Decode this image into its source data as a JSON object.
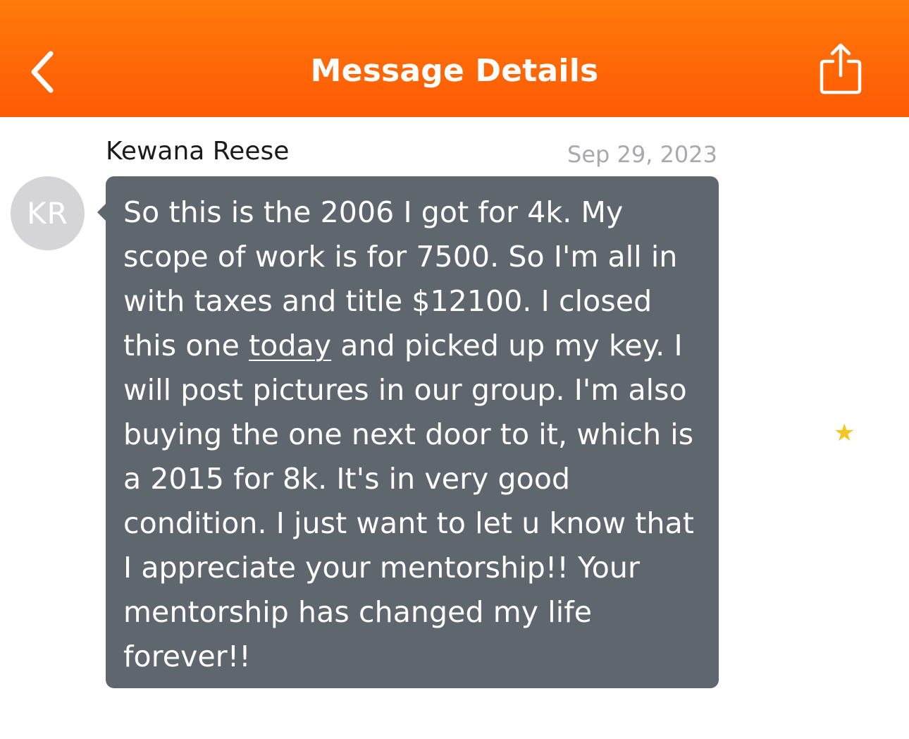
{
  "header": {
    "title": "Message Details",
    "back_icon": "chevron-left-icon",
    "share_icon": "share-icon",
    "background_color": "#ff6a08"
  },
  "message": {
    "sender_name": "Kewana Reese",
    "avatar_initials": "KR",
    "date": "Sep 29, 2023",
    "text_before_link": "So this is the 2006 I got for 4k. My scope of work is for 7500. So I'm all in with taxes and title $12100. I closed this one ",
    "link_text": "today",
    "text_after_link": " and picked up my key. I will post pictures in our group. I'm also buying the one next door to it, which is a 2015 for 8k. It's in very good condition. I just want to let u know that I appreciate your mentorship!! Your mentorship has changed my life forever!!",
    "bubble_color": "#5f666d"
  },
  "star": {
    "icon": "star-icon",
    "glyph": "★",
    "color": "#f3c623"
  }
}
